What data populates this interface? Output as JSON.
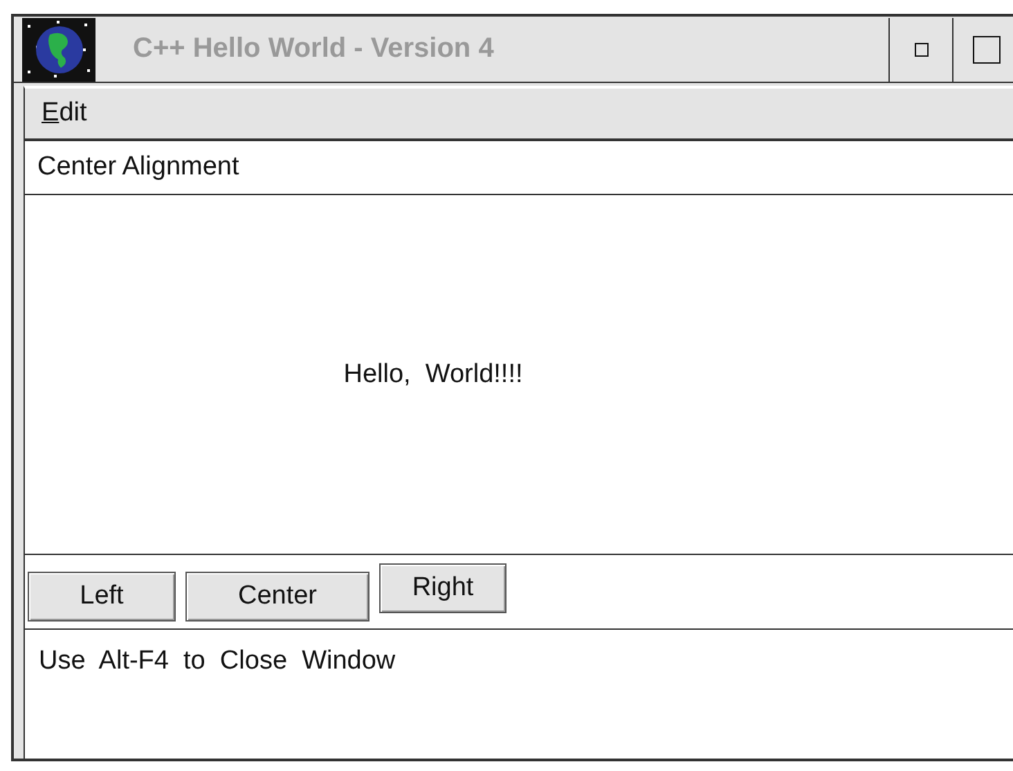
{
  "window": {
    "title": "C++ Hello World - Version 4"
  },
  "menu": [
    {
      "label": "Edit"
    }
  ],
  "status_header": "Center Alignment",
  "content": {
    "text": "Hello,  World!!!!"
  },
  "buttons": [
    {
      "label": "Left"
    },
    {
      "label": "Center"
    },
    {
      "label": "Right"
    }
  ],
  "message": "Use  Alt-F4  to  Close  Window"
}
